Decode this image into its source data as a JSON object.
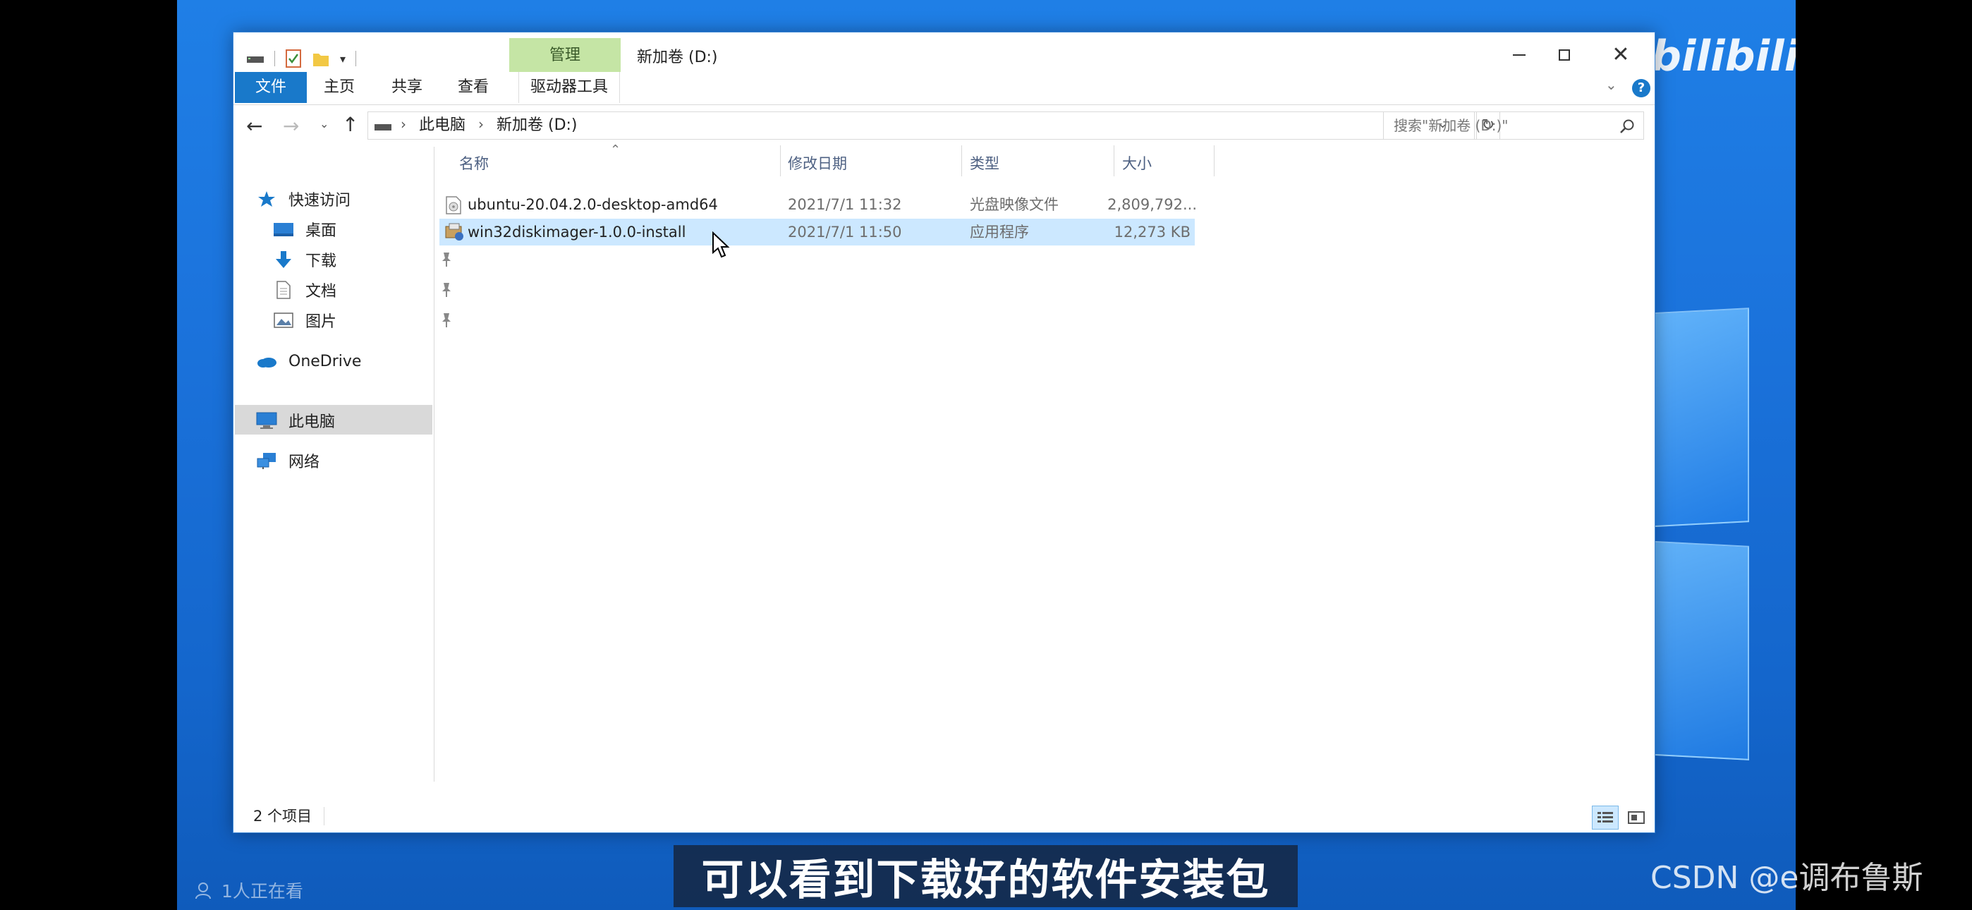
{
  "window": {
    "title": "新加卷 (D:)",
    "ribbon_context_tab": "管理",
    "tabs": [
      "文件",
      "主页",
      "共享",
      "查看",
      "驱动器工具"
    ]
  },
  "address": {
    "crumbs": [
      "此电脑",
      "新加卷 (D:)"
    ],
    "search_placeholder": "搜索\"新加卷 (D:)\""
  },
  "sidebar": {
    "quick_access": "快速访问",
    "quick_items": [
      "桌面",
      "下载",
      "文档",
      "图片"
    ],
    "onedrive": "OneDrive",
    "this_pc": "此电脑",
    "network": "网络"
  },
  "columns": {
    "name": "名称",
    "date": "修改日期",
    "type": "类型",
    "size": "大小"
  },
  "files": [
    {
      "name": "ubuntu-20.04.2.0-desktop-amd64",
      "date": "2021/7/1 11:32",
      "type": "光盘映像文件",
      "size": "2,809,792...",
      "icon": "disc-image-icon",
      "selected": false
    },
    {
      "name": "win32diskimager-1.0.0-install",
      "date": "2021/7/1 11:50",
      "type": "应用程序",
      "size": "12,273 KB",
      "icon": "installer-icon",
      "selected": true
    }
  ],
  "status": {
    "item_count": "2 个项目"
  },
  "overlay": {
    "subtitle": "可以看到下载好的软件安装包",
    "viewers": "1人正在看",
    "watermark": "CSDN @e调布鲁斯",
    "logo": "bilibili"
  },
  "colors": {
    "accent": "#1979ca",
    "manage_tab": "#c5e5a5",
    "selection": "#cce8ff",
    "desktop": "#1b73dc"
  }
}
